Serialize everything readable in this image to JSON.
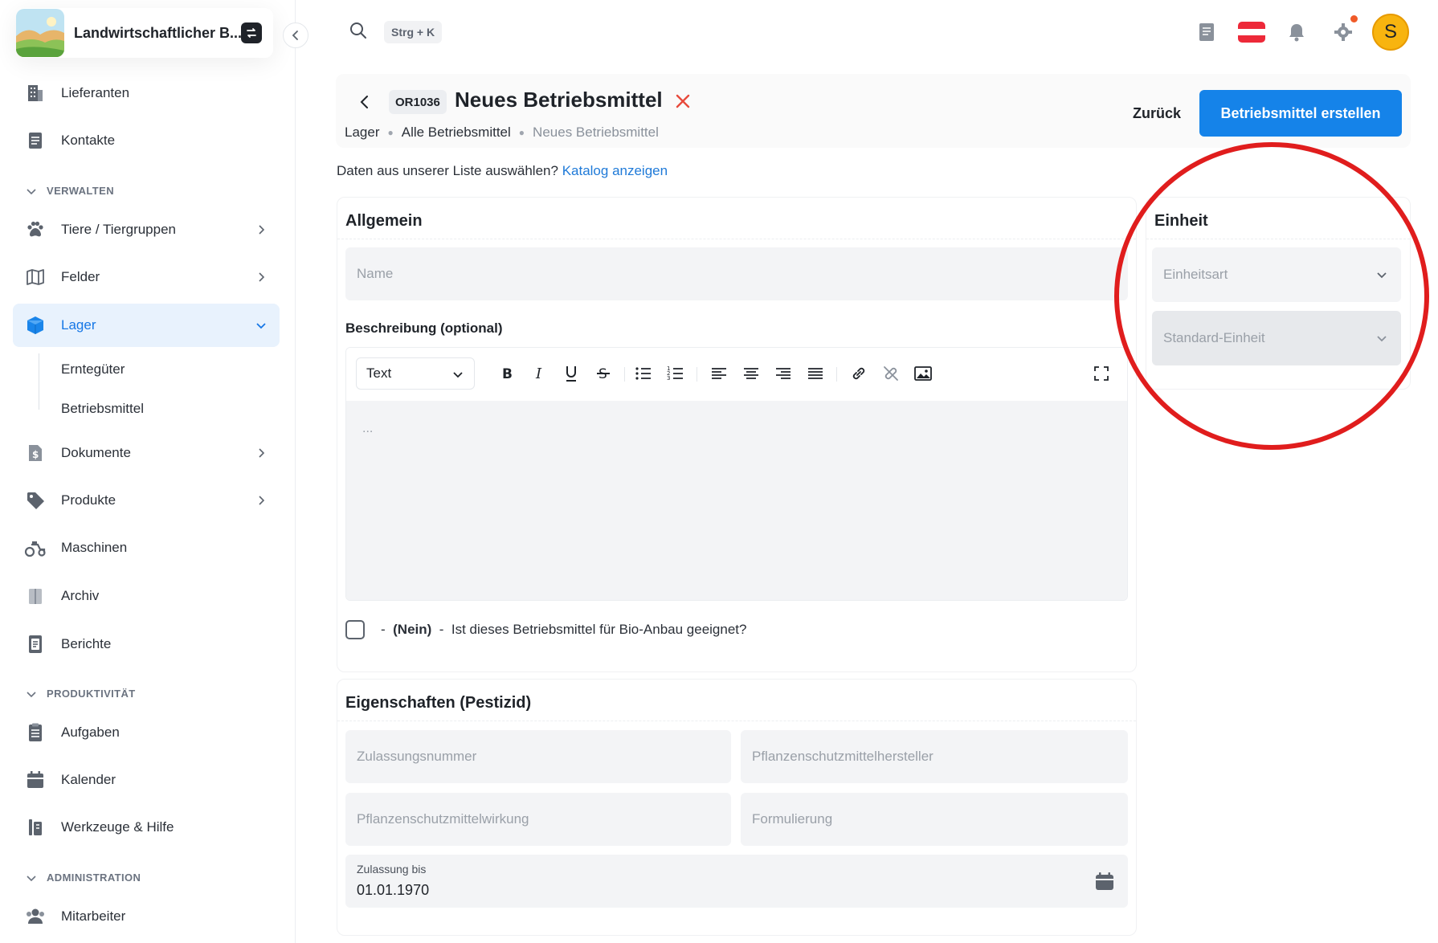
{
  "brand": {
    "title": "Landwirtschaftlicher B..."
  },
  "sidebar": {
    "items": [
      {
        "label": "Lieferanten",
        "icon": "building-icon"
      },
      {
        "label": "Kontakte",
        "icon": "contacts-icon"
      }
    ],
    "section_manage": "VERWALTEN",
    "manage_items": [
      {
        "label": "Tiere / Tiergruppen",
        "icon": "paw-icon"
      },
      {
        "label": "Felder",
        "icon": "map-icon"
      },
      {
        "label": "Lager",
        "icon": "box-icon",
        "active": true
      },
      {
        "label": "Dokumente",
        "icon": "document-dollar-icon"
      },
      {
        "label": "Produkte",
        "icon": "tag-icon"
      },
      {
        "label": "Maschinen",
        "icon": "tractor-icon"
      },
      {
        "label": "Archiv",
        "icon": "archive-icon"
      },
      {
        "label": "Berichte",
        "icon": "report-icon"
      }
    ],
    "lager_sub": [
      "Erntegüter",
      "Betriebsmittel"
    ],
    "section_productivity": "PRODUKTIVITÄT",
    "productivity_items": [
      {
        "label": "Aufgaben",
        "icon": "task-list-icon"
      },
      {
        "label": "Kalender",
        "icon": "calendar-icon"
      },
      {
        "label": "Werkzeuge & Hilfe",
        "icon": "tools-icon"
      }
    ],
    "section_admin": "ADMINISTRATION",
    "admin_items": [
      {
        "label": "Mitarbeiter",
        "icon": "users-icon"
      }
    ]
  },
  "topbar": {
    "shortcut": "Strg + K",
    "avatar_initial": "S"
  },
  "header": {
    "code": "OR1036",
    "title": "Neues Betriebsmittel",
    "breadcrumb": [
      "Lager",
      "Alle Betriebsmittel",
      "Neues Betriebsmittel"
    ],
    "back_label": "Zurück",
    "create_label": "Betriebsmittel erstellen"
  },
  "catalog": {
    "prompt": "Daten aus unserer Liste auswählen?",
    "link": "Katalog anzeigen"
  },
  "general": {
    "title": "Allgemein",
    "name_placeholder": "Name",
    "description_label": "Beschreibung (optional)",
    "format_value": "Text",
    "editor_placeholder": "...",
    "bio_prefix": "-",
    "bio_value": "(Nein)",
    "bio_sep": "-",
    "bio_question": "Ist dieses Betriebsmittel für Bio-Anbau geeignet?"
  },
  "unit": {
    "title": "Einheit",
    "type_placeholder": "Einheitsart",
    "default_placeholder": "Standard-Einheit"
  },
  "properties": {
    "title": "Eigenschaften (Pestizid)",
    "approval_number": "Zulassungsnummer",
    "manufacturer": "Pflanzenschutzmittelhersteller",
    "effect": "Pflanzenschutzmittelwirkung",
    "formulation": "Formulierung",
    "valid_until_label": "Zulassung bis",
    "valid_until_value": "01.01.1970"
  },
  "colors": {
    "primary": "#1583e9",
    "active_bg": "#e8f2fd",
    "annotation": "#e01d1d",
    "avatar": "#f8b40f"
  }
}
